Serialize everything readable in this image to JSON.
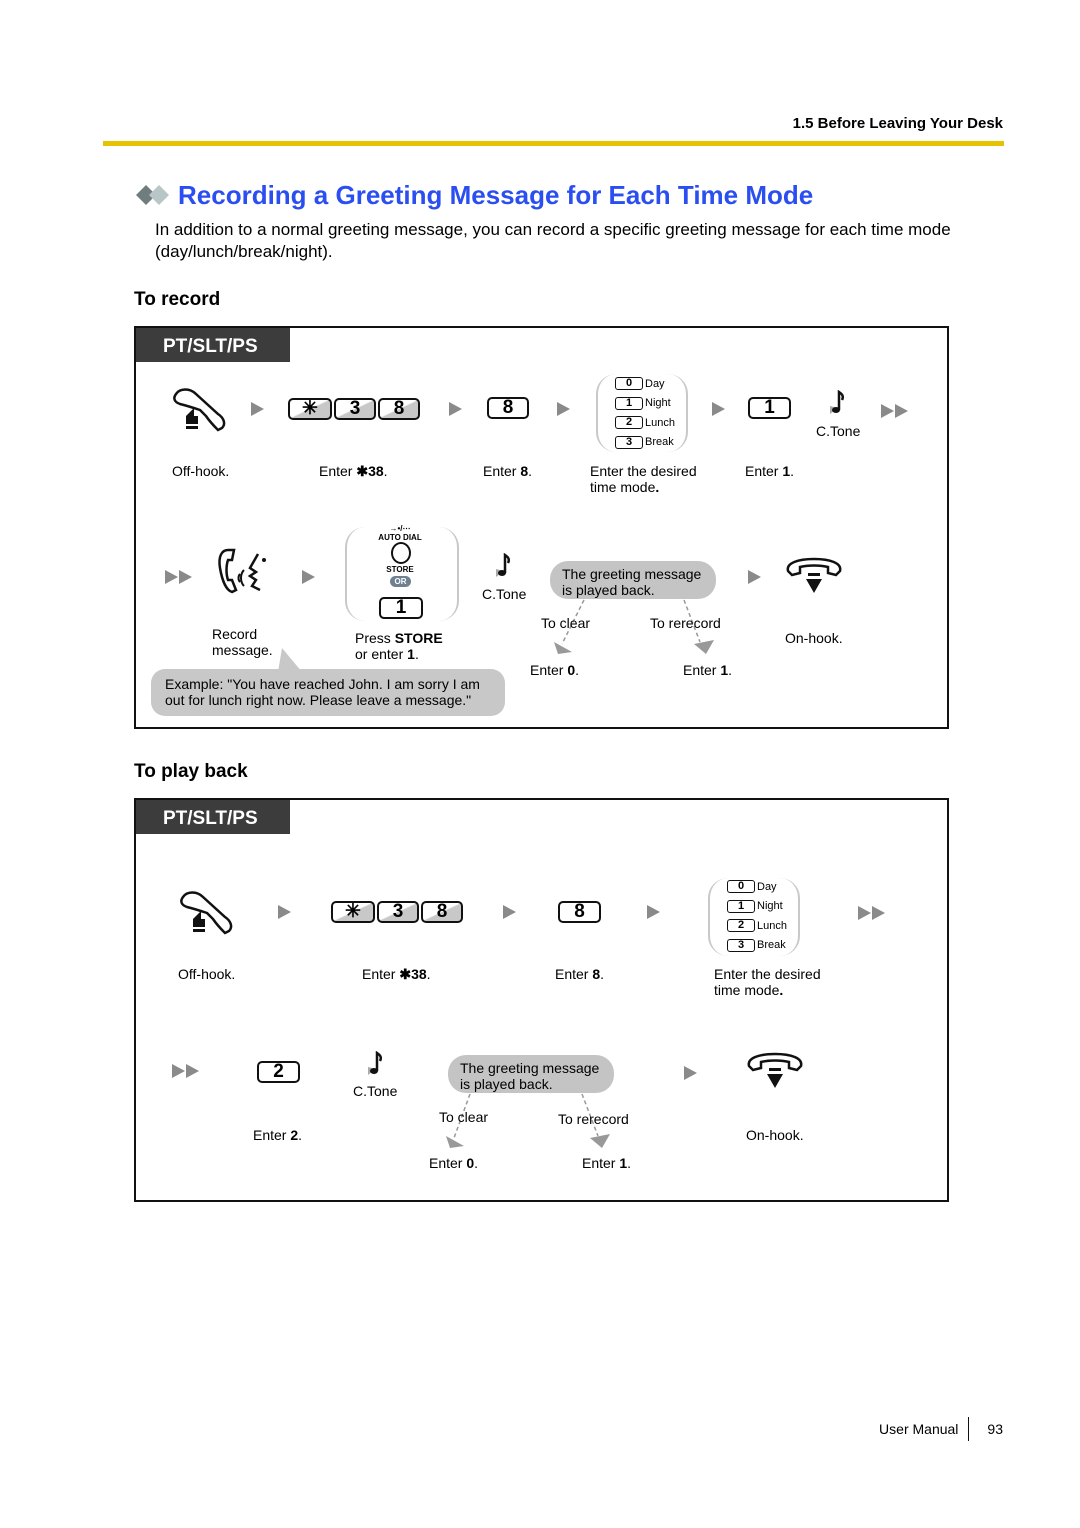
{
  "header": {
    "section": "1.5 Before Leaving Your Desk"
  },
  "title": "Recording a Greeting Message for Each Time Mode",
  "intro": "In addition to a normal greeting message, you can record a specific greeting message for each time mode (day/lunch/break/night).",
  "colors": {
    "title": "#2b4ef0",
    "rule": "#e6c300",
    "tag_bg": "#3c3c3c"
  },
  "record": {
    "heading": "To record",
    "tag": "PT/SLT/PS",
    "steps": {
      "offhook": "Off-hook.",
      "enter_code_prefix": "Enter ",
      "enter_code_bold": "✱38",
      "enter_8_prefix": "Enter ",
      "enter_8_bold": "8",
      "mode_line1": "Enter the desired",
      "mode_line2": "time mode",
      "enter_1_prefix": "Enter ",
      "enter_1_bold": "1",
      "ctone": "C.Tone",
      "record_line1": "Record",
      "record_line2": "message.",
      "store_prefix": "Press ",
      "store_bold": "STORE",
      "store_line2_prefix": "or enter ",
      "store_line2_bold": "1",
      "autodial": "AUTO DIAL",
      "store_label": "STORE",
      "or": "OR",
      "ctone2": "C.Tone",
      "bubble_line1": "The greeting message",
      "bubble_line2": "is played back.",
      "to_clear": "To clear",
      "to_rerecord": "To rerecord",
      "enter_0_prefix": "Enter ",
      "enter_0_bold": "0",
      "enter_1b_prefix": "Enter ",
      "enter_1b_bold": "1",
      "onhook": "On-hook.",
      "example_line1": "Example: \"You have reached John. I am sorry I am",
      "example_line2": "out for lunch right now. Please leave a message.\""
    },
    "keys": {
      "star": "✳",
      "k3": "3",
      "k8": "8",
      "k8b": "8",
      "k1": "1",
      "store1": "1"
    }
  },
  "modes": [
    {
      "key": "0",
      "label": "Day"
    },
    {
      "key": "1",
      "label": "Night"
    },
    {
      "key": "2",
      "label": "Lunch"
    },
    {
      "key": "3",
      "label": "Break"
    }
  ],
  "playback": {
    "heading": "To play back",
    "tag": "PT/SLT/PS",
    "steps": {
      "offhook": "Off-hook.",
      "enter_code_prefix": "Enter ",
      "enter_code_bold": "✱38",
      "enter_8_prefix": "Enter ",
      "enter_8_bold": "8",
      "mode_line1": "Enter the desired",
      "mode_line2": "time mode",
      "enter_2_prefix": "Enter ",
      "enter_2_bold": "2",
      "ctone": "C.Tone",
      "bubble_line1": "The greeting message",
      "bubble_line2": "is played back.",
      "to_clear": "To clear",
      "to_rerecord": "To rerecord",
      "enter_0_prefix": "Enter ",
      "enter_0_bold": "0",
      "enter_1_prefix": "Enter ",
      "enter_1_bold": "1",
      "onhook": "On-hook."
    },
    "keys": {
      "star": "✳",
      "k3": "3",
      "k8": "8",
      "k8b": "8",
      "k2": "2"
    }
  },
  "footer": {
    "label": "User Manual",
    "page": "93"
  }
}
